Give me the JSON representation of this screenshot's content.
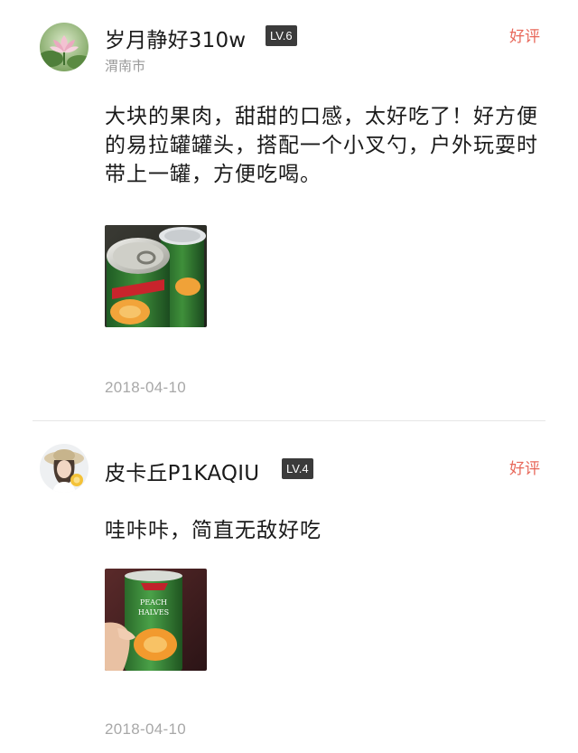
{
  "reviews": [
    {
      "username": "岁月静好310w",
      "level": "LV.6",
      "location": "渭南市",
      "rating_label": "好评",
      "content": "大块的果肉，甜甜的口感，太好吃了！好方便的易拉罐罐头，搭配一个小叉勺，户外玩耍时带上一罐，方便吃喝。",
      "date": "2018-04-10",
      "avatar_icon": "lotus-flower-avatar",
      "photo": "peach-can-pull-tab-photo"
    },
    {
      "username": "皮卡丘P1KAQIU",
      "level": "LV.4",
      "rating_label": "好评",
      "content": "哇咔咔，简直无敌好吃",
      "date": "2018-04-10",
      "avatar_icon": "girl-with-hat-avatar",
      "photo": "peach-halves-can-in-hand-photo",
      "photo_label": "PEACH HALVES"
    }
  ],
  "colors": {
    "rating": "#e8685a",
    "badge_bg": "#3b3b3b",
    "meta_text": "#9a9a9a"
  }
}
